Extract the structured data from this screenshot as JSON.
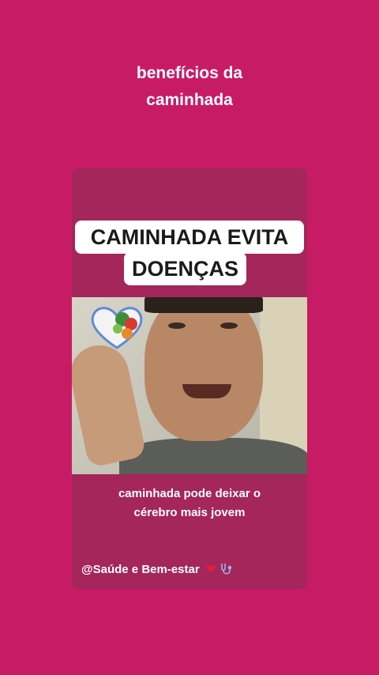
{
  "story": {
    "title_line1": "benefícios da",
    "title_line2": "caminhada"
  },
  "card": {
    "headline_line1": "CAMINHADA EVITA",
    "headline_line2": "DOENÇAS",
    "caption_line1": "caminhada pode deixar o",
    "caption_line2": "cérebro mais jovem",
    "credit_text": "@Saúde e Bem-estar",
    "credit_icons": [
      "heart-icon",
      "stethoscope-icon"
    ]
  },
  "colors": {
    "background": "#c81b66",
    "card": "#a4265a",
    "text": "#ffffff",
    "headline_bg": "#ffffff",
    "headline_text": "#1a1a1a"
  }
}
